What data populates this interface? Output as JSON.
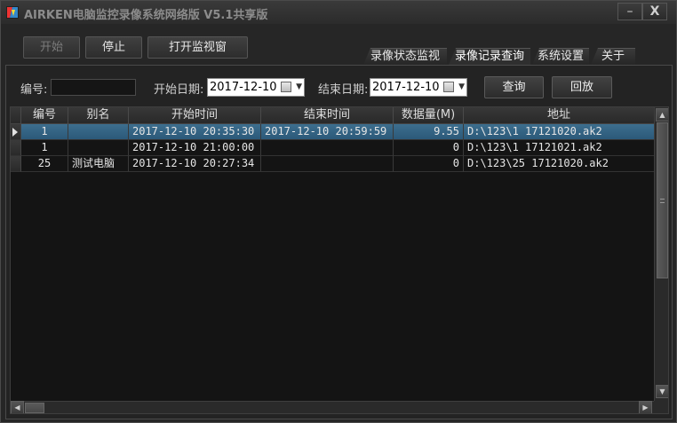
{
  "window": {
    "title": "AIRKEN电脑监控录像系统网络版 V5.1共享版",
    "minimize_glyph": "–",
    "close_glyph": "X"
  },
  "toolbar": {
    "start_label": "开始",
    "stop_label": "停止",
    "open_monitor_label": "打开监视窗"
  },
  "tabs": [
    {
      "label": "录像状态监视",
      "active": false
    },
    {
      "label": "录像记录查询",
      "active": true
    },
    {
      "label": "系统设置",
      "active": false
    },
    {
      "label": "关于",
      "active": false
    }
  ],
  "filters": {
    "id_label": "编号:",
    "id_value": "",
    "start_date_label": "开始日期:",
    "start_date_value": "2017-12-10",
    "end_date_label": "结束日期:",
    "end_date_value": "2017-12-10",
    "query_label": "查询",
    "play_label": "回放"
  },
  "grid": {
    "columns": [
      "编号",
      "别名",
      "开始时间",
      "结束时间",
      "数据量(M)",
      "地址"
    ],
    "rows": [
      {
        "id": "1",
        "alias": "",
        "start": "2017-12-10  20:35:30",
        "end": "2017-12-10  20:59:59",
        "size": "9.55",
        "path": "D:\\123\\1 17121020.ak2",
        "selected": true
      },
      {
        "id": "1",
        "alias": "",
        "start": "2017-12-10  21:00:00",
        "end": "",
        "size": "0",
        "path": "D:\\123\\1 17121021.ak2",
        "selected": false
      },
      {
        "id": "25",
        "alias": "测试电脑",
        "start": "2017-12-10  20:27:34",
        "end": "",
        "size": "0",
        "path": "D:\\123\\25 17121020.ak2",
        "selected": false
      }
    ]
  },
  "colors": {
    "background": "#262626",
    "selected_row": "#2f5f80",
    "text": "#e6e6e6"
  },
  "icons": {
    "app": "app-logo-icon",
    "calendar": "calendar-icon",
    "row_pointer": "row-pointer-icon"
  }
}
